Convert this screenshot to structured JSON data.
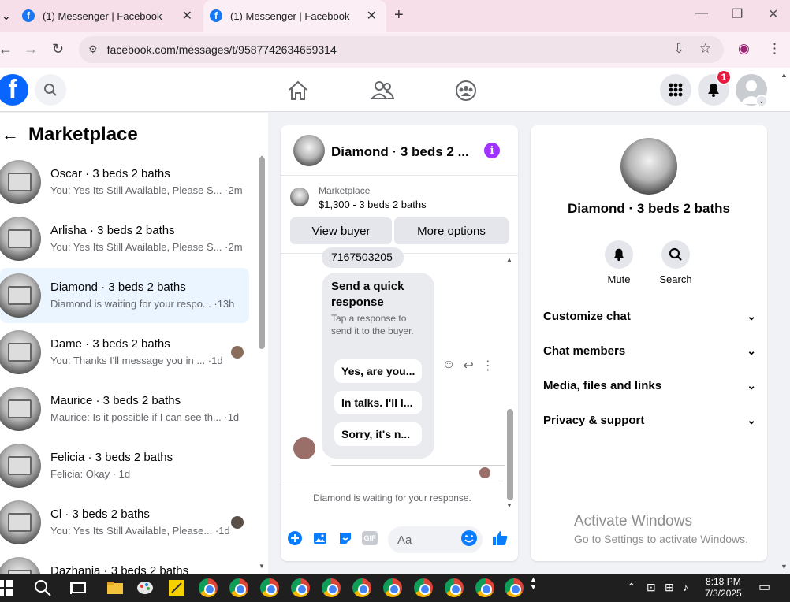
{
  "browser": {
    "tabs": [
      {
        "title": "(1) Messenger | Facebook"
      },
      {
        "title": "(1) Messenger | Facebook"
      }
    ],
    "url": "facebook.com/messages/t/9587742634659314"
  },
  "header": {
    "notification_count": "1"
  },
  "left_panel": {
    "title": "Marketplace",
    "conversations": [
      {
        "name": "Oscar · 3 beds 2 baths",
        "preview": "You: Yes Its Still Available, Please S... ·2m"
      },
      {
        "name": "Arlisha · 3 beds 2 baths",
        "preview": "You: Yes Its Still Available, Please S... ·2m"
      },
      {
        "name": "Diamond · 3 beds 2 baths",
        "preview": "Diamond is waiting for your respo... ·13h"
      },
      {
        "name": "Dame · 3 beds 2 baths",
        "preview": "You: Thanks I'll message you in ... ·1d"
      },
      {
        "name": "Maurice · 3 beds 2 baths",
        "preview": "Maurice: Is it possible if I can see th... ·1d"
      },
      {
        "name": "Felicia · 3 beds 2 baths",
        "preview": "Felicia: Okay · 1d"
      },
      {
        "name": "Cl · 3 beds 2 baths",
        "preview": "You: Yes Its Still Available, Please... ·1d"
      },
      {
        "name": "Dazhania · 3 beds 2 baths",
        "preview": ""
      }
    ]
  },
  "chat": {
    "title": "Diamond · 3 beds 2 ...",
    "info_glyph": "i",
    "marketplace_label": "Marketplace",
    "listing": "$1,300 - 3 beds 2 baths",
    "view_buyer": "View buyer",
    "more_options": "More options",
    "phone_fragment": "7167503205",
    "quick_response_title": "Send a quick response",
    "quick_response_sub": "Tap a response to send it to the buyer.",
    "quick_options": [
      "Yes, are you...",
      "In talks. I'll l...",
      "Sorry, it's n..."
    ],
    "waiting_text": "Diamond is waiting for your response.",
    "composer_placeholder": "Aa",
    "gif_label": "GIF"
  },
  "right_panel": {
    "name": "Diamond · 3 beds 2 baths",
    "mute_label": "Mute",
    "search_label": "Search",
    "sections": [
      "Customize chat",
      "Chat members",
      "Media, files and links",
      "Privacy & support"
    ],
    "activate_title": "Activate Windows",
    "activate_sub": "Go to Settings to activate Windows."
  },
  "taskbar": {
    "time": "8:18 PM",
    "date": "7/3/2025"
  },
  "colors": {
    "fb_blue": "#0866ff",
    "messenger_blue": "#0a7cff",
    "info_purple": "#a033ff",
    "badge_red": "#e41e3f",
    "active_row": "#ebf5ff"
  }
}
